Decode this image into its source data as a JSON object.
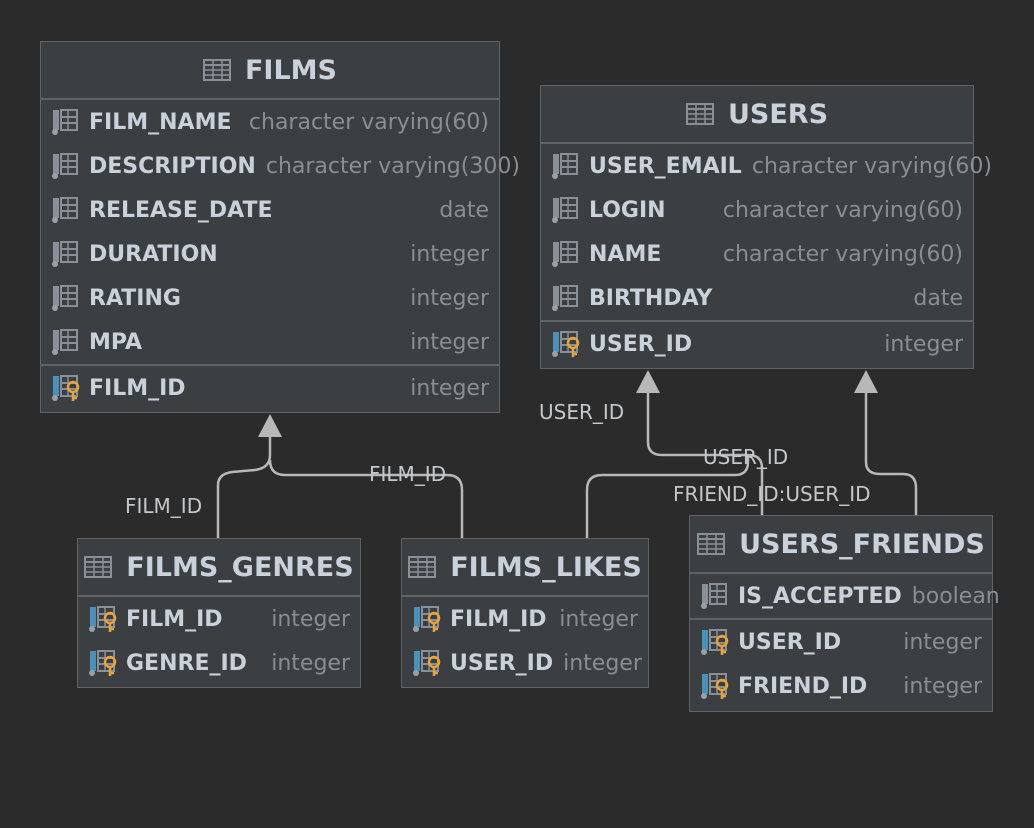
{
  "colors": {
    "background": "#2b2b2b",
    "table_fill": "#3c3f41",
    "border": "#5f6366",
    "column_name": "#c9d1da",
    "column_type": "#8a8e91",
    "key_icon": "#e8a43c",
    "edge": "#b8b8b8"
  },
  "tables": {
    "films": {
      "name": "FILMS",
      "columns": [
        {
          "name": "FILM_NAME",
          "type": "character varying(60)"
        },
        {
          "name": "DESCRIPTION",
          "type": "character varying(300)"
        },
        {
          "name": "RELEASE_DATE",
          "type": "date"
        },
        {
          "name": "DURATION",
          "type": "integer"
        },
        {
          "name": "RATING",
          "type": "integer"
        },
        {
          "name": "MPA",
          "type": "integer"
        }
      ],
      "keys": [
        {
          "name": "FILM_ID",
          "type": "integer"
        }
      ]
    },
    "users": {
      "name": "USERS",
      "columns": [
        {
          "name": "USER_EMAIL",
          "type": "character varying(60)"
        },
        {
          "name": "LOGIN",
          "type": "character varying(60)"
        },
        {
          "name": "NAME",
          "type": "character varying(60)"
        },
        {
          "name": "BIRTHDAY",
          "type": "date"
        }
      ],
      "keys": [
        {
          "name": "USER_ID",
          "type": "integer"
        }
      ]
    },
    "films_genres": {
      "name": "FILMS_GENRES",
      "columns": [],
      "keys": [
        {
          "name": "FILM_ID",
          "type": "integer"
        },
        {
          "name": "GENRE_ID",
          "type": "integer"
        }
      ]
    },
    "films_likes": {
      "name": "FILMS_LIKES",
      "columns": [],
      "keys": [
        {
          "name": "FILM_ID",
          "type": "integer"
        },
        {
          "name": "USER_ID",
          "type": "integer"
        }
      ]
    },
    "users_friends": {
      "name": "USERS_FRIENDS",
      "columns": [
        {
          "name": "IS_ACCEPTED",
          "type": "boolean"
        }
      ],
      "keys": [
        {
          "name": "USER_ID",
          "type": "integer"
        },
        {
          "name": "FRIEND_ID",
          "type": "integer"
        }
      ]
    }
  },
  "relations": [
    {
      "from": "films_genres",
      "to": "films",
      "label": "FILM_ID"
    },
    {
      "from": "films_likes",
      "to": "films",
      "label": "FILM_ID"
    },
    {
      "from": "films_likes",
      "to": "users",
      "label": "USER_ID"
    },
    {
      "from": "users_friends",
      "to": "users",
      "label": "USER_ID"
    },
    {
      "from": "users_friends",
      "to": "users",
      "label": "FRIEND_ID:USER_ID"
    }
  ]
}
